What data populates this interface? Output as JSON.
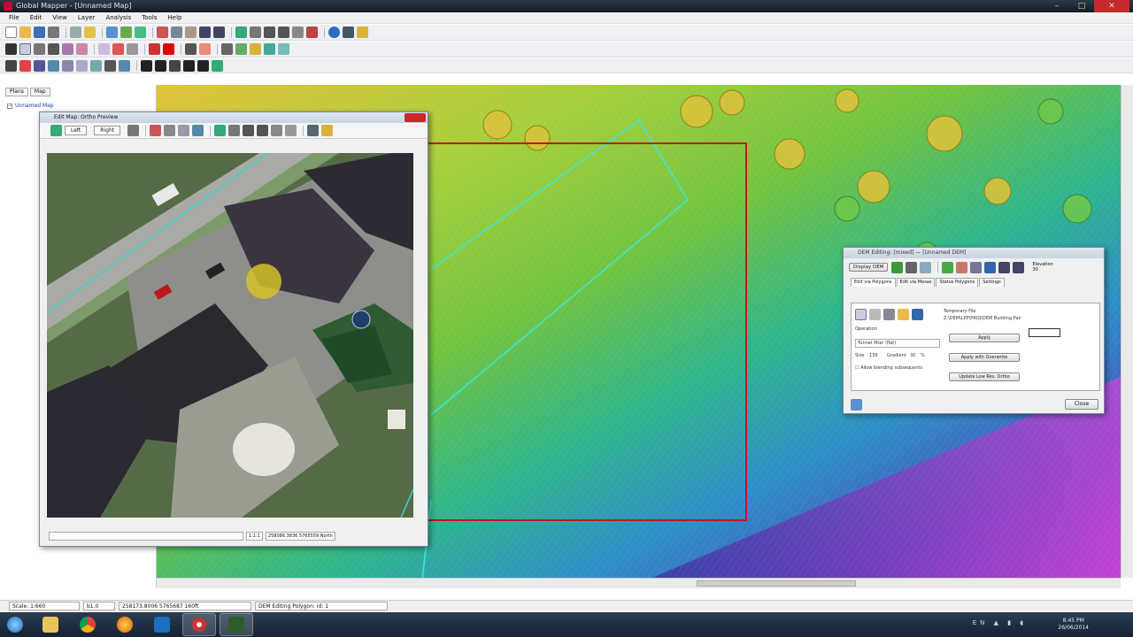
{
  "window": {
    "title": "Global Mapper - [Unnamed Map]",
    "min": "–",
    "max": "□",
    "close": "✕"
  },
  "menu": [
    "File",
    "Edit",
    "View",
    "Layer",
    "Analysis",
    "Tools",
    "Help"
  ],
  "left_panel": {
    "tabs": [
      "Plans",
      "Map"
    ],
    "tree_root": "Unnamed Map",
    "expand": "−"
  },
  "ortho_window": {
    "title": "Edit Map: Ortho Preview",
    "view_left": "Left",
    "view_right": "Right",
    "status_scale": "1:1:1",
    "status_coords": "258086.3836 5765559 North"
  },
  "dem_window": {
    "title": "DEM Editing: [mixed]  —  [Unnamed DEM]",
    "display_btn": "Display DEM",
    "elevation_label": "Elevation",
    "elevation_value": "30",
    "tabs": [
      "Edit via Polygons",
      "Edit via Mesas",
      "Status Polygons",
      "Settings"
    ],
    "temp_file_label": "Temporary File",
    "temp_file_path": "Z:\\DEM\\LPP\\PROJ\\DEM Building Pan",
    "operation_label": "Operation",
    "operation_value": "Tunnel filter (flat)",
    "size_label": "Size",
    "size_value": "130",
    "gradient_label": "Gradient",
    "gradient_value": "30",
    "gradient_unit": "%",
    "checkbox_label": "Allow blending subsequents",
    "apply": "Apply",
    "apply_overwrite": "Apply with Overwrite",
    "update": "Update Low Res. Ortho",
    "close": "Close"
  },
  "statusbar": {
    "scale": "Scale: 1:660",
    "v1": "b1.0",
    "coords": "258173.8006  5765687  160ft",
    "layer": "DEM Editing Polygon: id: 1"
  },
  "taskbar": {
    "time": "8:45 PM",
    "date": "26/06/2014",
    "lang": "EN"
  }
}
